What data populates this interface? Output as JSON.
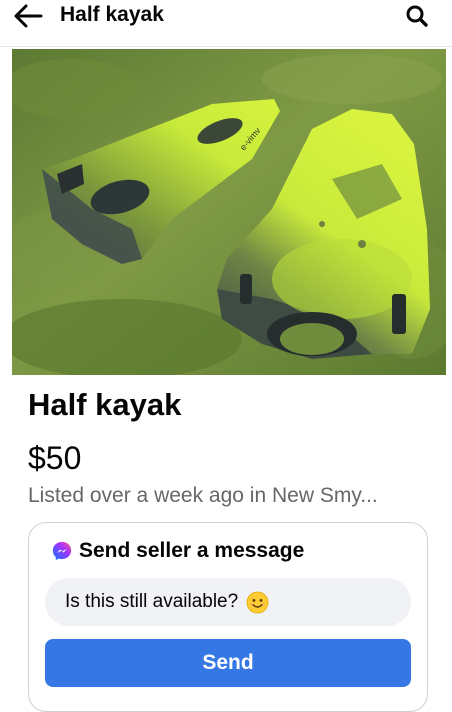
{
  "header": {
    "title": "Half kayak",
    "back_icon": "arrow-left-icon",
    "search_icon": "search-icon"
  },
  "listing": {
    "photo_alt": "Two halves of a green kayak lying on grass",
    "title": "Half kayak",
    "price": "$50",
    "meta": "Listed over a week ago in New Smy..."
  },
  "message_box": {
    "heading": "Send seller a message",
    "heading_icon": "messenger-icon",
    "input_value": "Is this still available?",
    "emoji": "smiling-face-emoji",
    "send_label": "Send"
  },
  "colors": {
    "accent": "#3578e5",
    "secondary_text": "#65676b",
    "input_bg": "#f0f2f5",
    "border": "#ced0d4"
  }
}
